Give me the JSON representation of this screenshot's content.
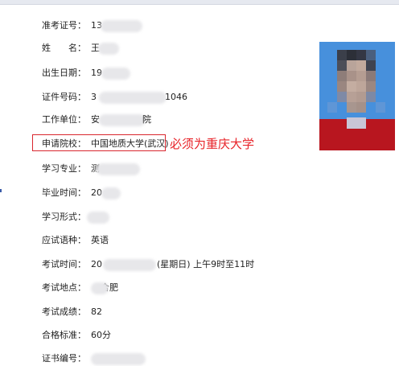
{
  "fields": {
    "exam_id": {
      "label": "准考证号：",
      "value": "13"
    },
    "name": {
      "label": "姓　　名：",
      "value": "王"
    },
    "birth_date": {
      "label": "出生日期：",
      "value": "19"
    },
    "id_number": {
      "label": "证件号码：",
      "value": "3",
      "value_tail": "1046"
    },
    "employer": {
      "label": "工作单位：",
      "value": "安",
      "value_tail": "院"
    },
    "applied_school": {
      "label": "申请院校：",
      "value": "中国地质大学(武汉)"
    },
    "major": {
      "label": "学习专业：",
      "value": "测"
    },
    "graduation_time": {
      "label": "毕业时间：",
      "value": "20"
    },
    "study_form": {
      "label": "学习形式：",
      "value": ""
    },
    "exam_language": {
      "label": "应试语种：",
      "value": "英语"
    },
    "exam_time": {
      "label": "考试时间：",
      "value": "20",
      "value_tail": "(星期日) 上午9时至11时"
    },
    "exam_location": {
      "label": "考试地点：",
      "value": "合肥"
    },
    "score": {
      "label": "考试成绩：",
      "value": "82"
    },
    "passing_standard": {
      "label": "合格标准：",
      "value": "60分"
    },
    "certificate_number": {
      "label": "证书编号：",
      "value": ""
    }
  },
  "annotation": {
    "text": "必须为重庆大学",
    "color": "#e8242a"
  },
  "colors": {
    "highlight_border": "#d9262e",
    "photo_background": "#4790dc",
    "photo_shirt": "#b8161f"
  }
}
